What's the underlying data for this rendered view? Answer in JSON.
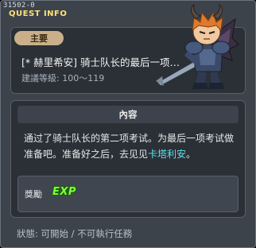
{
  "window": {
    "id": "31502-0",
    "title": "QUEST INFO"
  },
  "quest": {
    "category": "主要",
    "title": "[* 赫里希安] 骑士队长的最后一项…",
    "level": "建議等級: 100～119"
  },
  "content": {
    "heading": "內容",
    "description_before": "通过了骑士队长的第二项考试。为最后一项考试做准备吧。准备好之后，去见见",
    "npc_name": "卡塔利安",
    "description_after": "。"
  },
  "reward": {
    "label": "獎勵",
    "exp": "EXP"
  },
  "status": "狀態: 可開始 / 不可執行任務",
  "colors": {
    "title": "#ffe27a",
    "npc": "#5ee2ee",
    "exp": "#7dff3a",
    "badge": "#c9b08a"
  },
  "icons": {
    "character": "demon-knight-character-icon"
  }
}
